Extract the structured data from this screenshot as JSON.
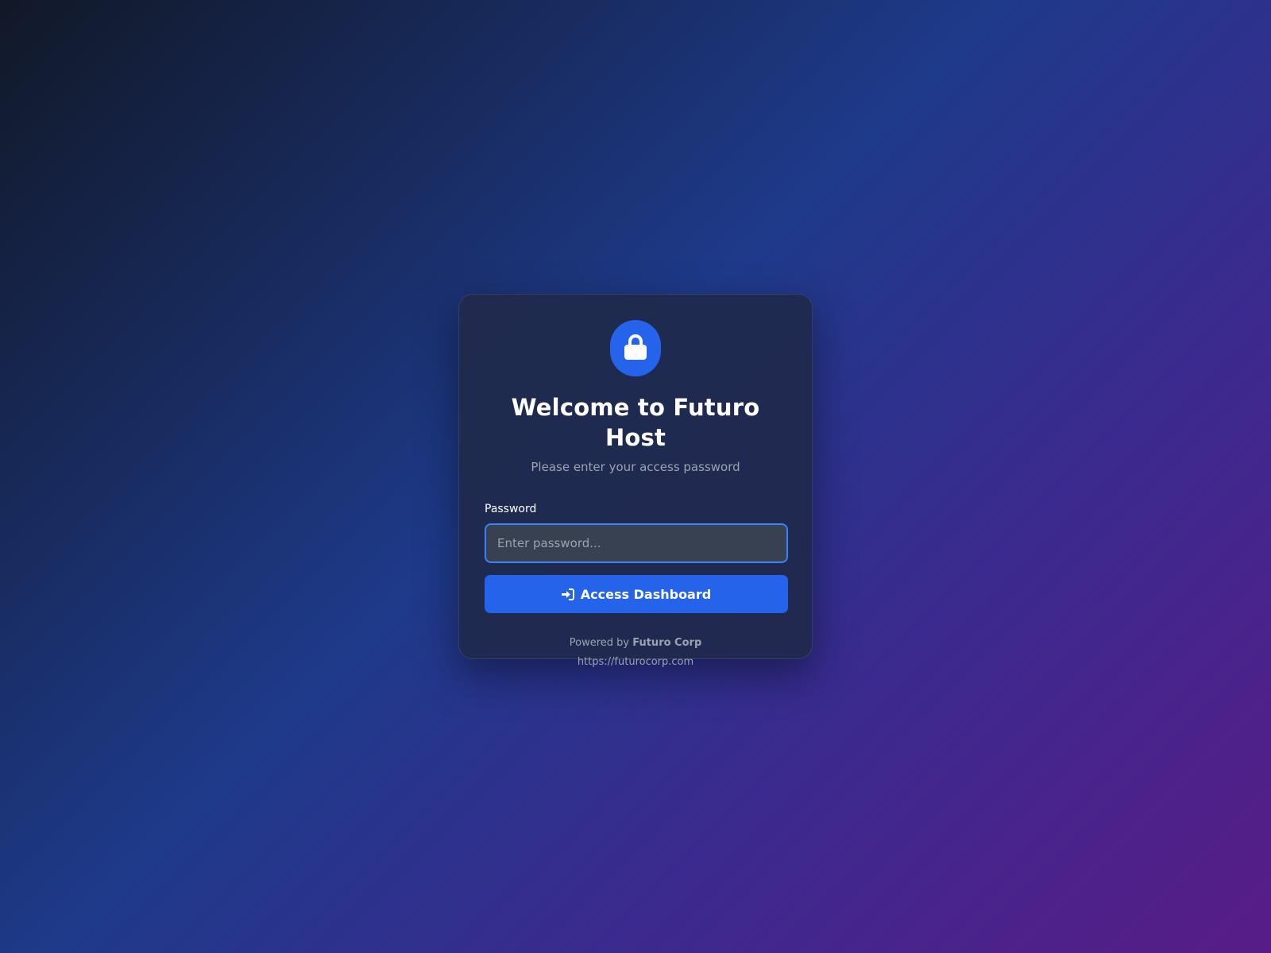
{
  "login": {
    "title": "Welcome to Futuro Host",
    "subtitle": "Please enter your access password",
    "password_label": "Password",
    "password_placeholder": "Enter password...",
    "password_value": "",
    "submit_label": "Access Dashboard",
    "submit_icon": "sign-in-icon",
    "badge_icon": "lock-icon"
  },
  "footer": {
    "powered_prefix": "Powered by",
    "company": "Futuro Corp",
    "url": "https://futurocorp.com"
  },
  "colors": {
    "accent": "#2563eb",
    "card_bg": "#1f2a4b",
    "input_bg": "#374151",
    "input_border": "#3b82f6",
    "muted_text": "#9ca3af"
  }
}
